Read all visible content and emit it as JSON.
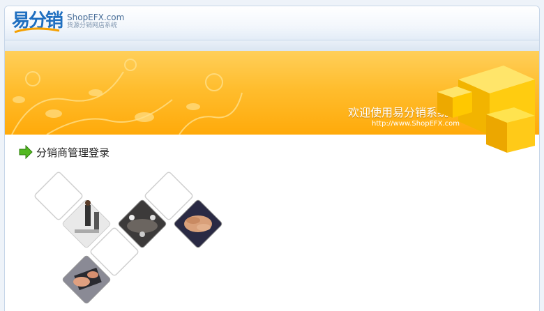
{
  "header": {
    "logo_cn": "易分销",
    "logo_en": "ShopEFX.com",
    "tagline": "货源分销网店系统"
  },
  "banner": {
    "welcome": "欢迎使用易分销系统",
    "url": "http://www.ShopEFX.com",
    "colors": {
      "top": "#ffcf5a",
      "bottom": "#ffaa0a",
      "cube": "#ffd21a"
    }
  },
  "login": {
    "title": "分销商管理登录",
    "icon": "green-arrow-right-icon"
  },
  "tiles": {
    "images": [
      "office-meeting-photo",
      "business-people-table-photo",
      "joined-hands-photo",
      "typing-keyboard-photo"
    ]
  }
}
